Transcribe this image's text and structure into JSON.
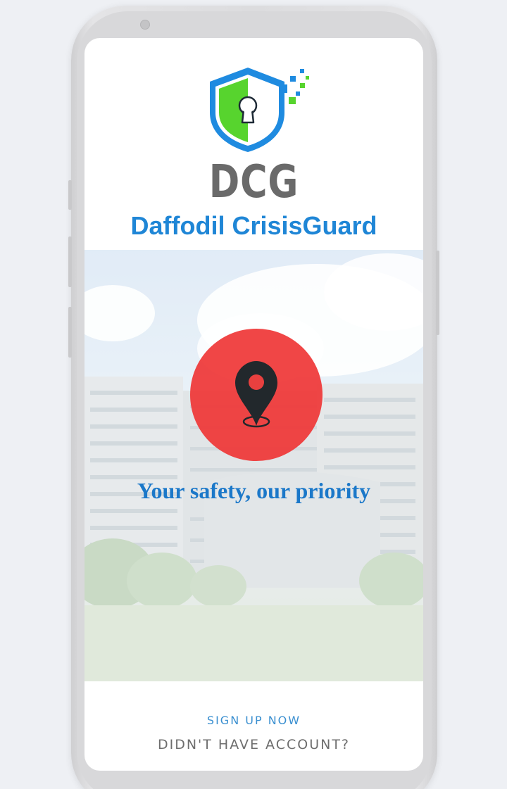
{
  "app": {
    "abbreviation": "DCG",
    "name": "Daffodil CrisisGuard",
    "tagline": "Your safety, our priority"
  },
  "actions": {
    "signup_label": "SIGN UP NOW",
    "account_prompt": "DIDN'T HAVE ACCOUNT?"
  },
  "icons": {
    "logo": "shield-keyhole-icon",
    "hero_pin": "location-pin-icon"
  },
  "colors": {
    "brand_blue": "#1f86d6",
    "shield_green": "#57d42e",
    "pin_circle_red": "#ef3636",
    "abbr_gray": "#6a6a6a"
  }
}
